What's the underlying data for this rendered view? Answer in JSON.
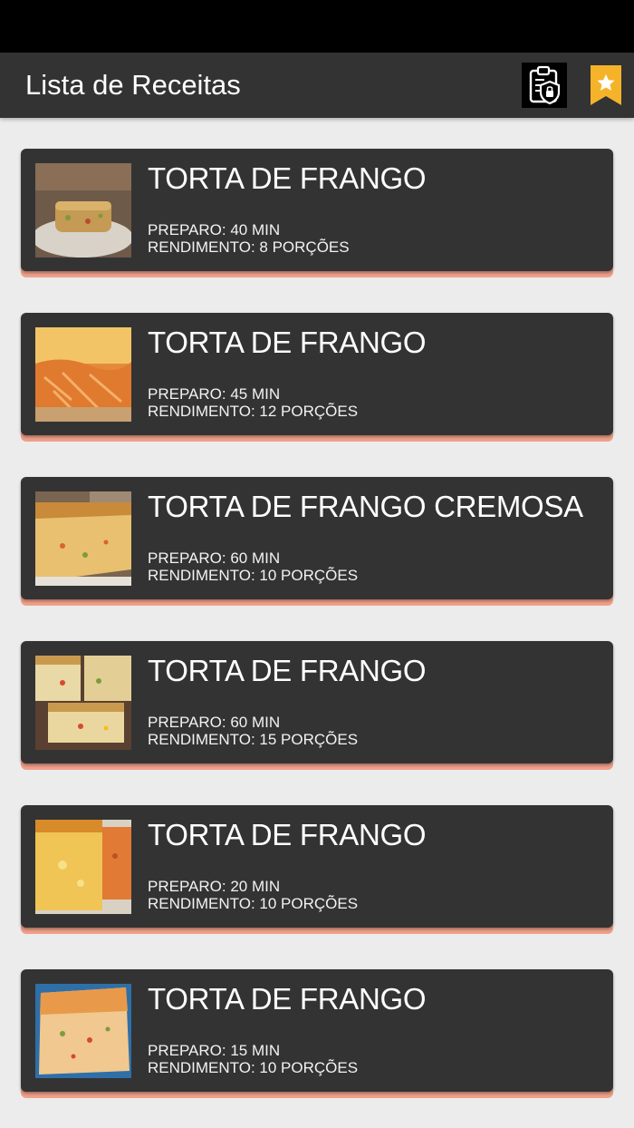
{
  "app_bar": {
    "title": "Lista de Receitas",
    "privacy_icon": "clipboard-lock-icon",
    "favorites_icon": "star-bookmark-icon",
    "accent_color": "#f5b32a"
  },
  "recipes": [
    {
      "title": "TORTA DE FRANGO",
      "prep": "PREPARO: 40 MIN",
      "yield": "RENDIMENTO: 8 PORÇÕES"
    },
    {
      "title": "TORTA DE FRANGO",
      "prep": "PREPARO: 45 MIN",
      "yield": "RENDIMENTO: 12 PORÇÕES"
    },
    {
      "title": "TORTA DE FRANGO CREMOSA",
      "prep": "PREPARO: 60 MIN",
      "yield": "RENDIMENTO: 10 PORÇÕES"
    },
    {
      "title": "TORTA DE FRANGO",
      "prep": "PREPARO: 60 MIN",
      "yield": "RENDIMENTO: 15 PORÇÕES"
    },
    {
      "title": "TORTA DE FRANGO",
      "prep": "PREPARO: 20 MIN",
      "yield": "RENDIMENTO: 10 PORÇÕES"
    },
    {
      "title": "TORTA DE FRANGO",
      "prep": "PREPARO: 15 MIN",
      "yield": "RENDIMENTO: 10 PORÇÕES"
    }
  ],
  "colors": {
    "card_bg": "#333333",
    "card_accent": "#f0a08a",
    "page_bg": "#ececec"
  }
}
